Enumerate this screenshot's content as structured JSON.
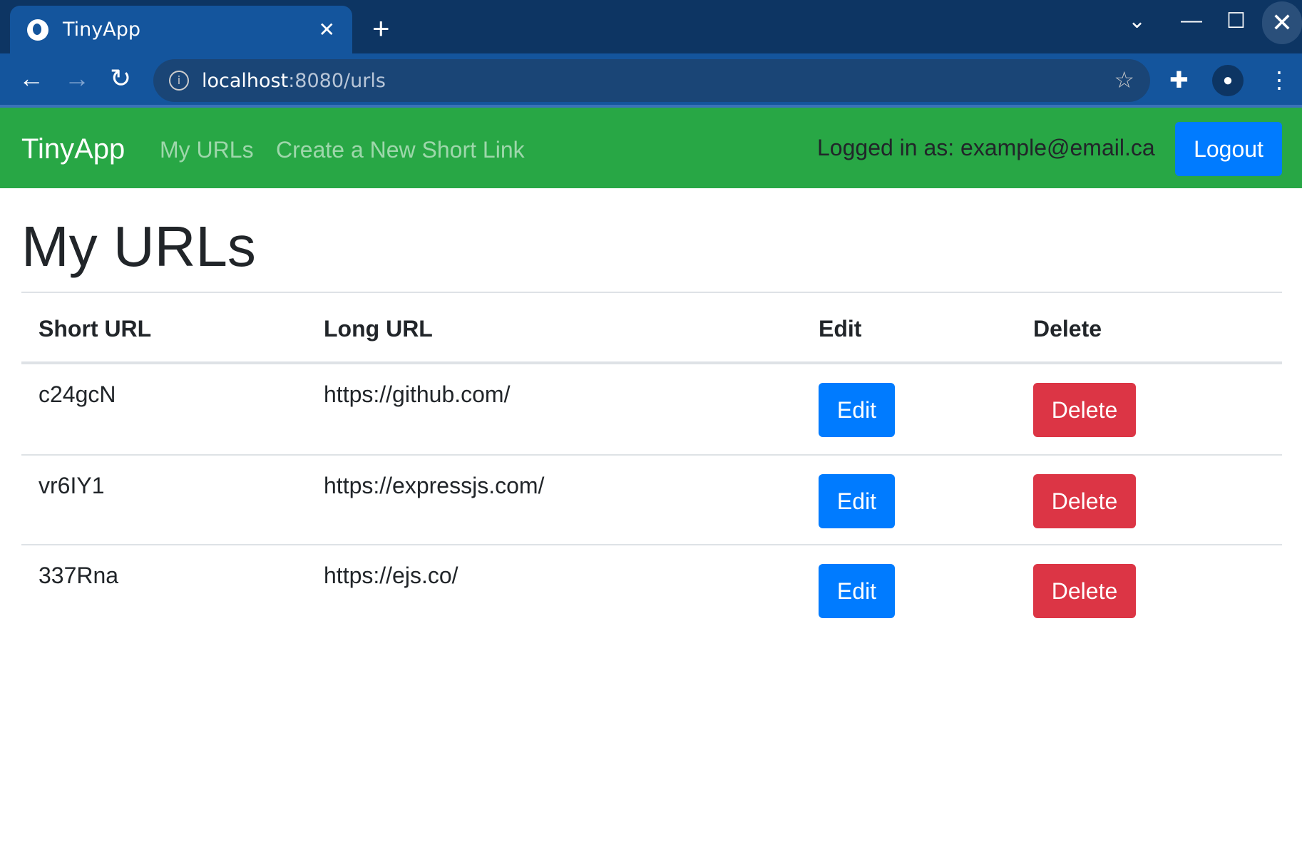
{
  "browser": {
    "tab_title": "TinyApp",
    "url_host": "localhost",
    "url_rest": ":8080/urls"
  },
  "navbar": {
    "brand": "TinyApp",
    "links": [
      "My URLs",
      "Create a New Short Link"
    ],
    "logged_in": "Logged in as: example@email.ca",
    "logout": "Logout"
  },
  "page": {
    "title": "My URLs"
  },
  "table": {
    "headers": [
      "Short URL",
      "Long URL",
      "Edit",
      "Delete"
    ],
    "rows": [
      {
        "short": "c24gcN",
        "long": "https://github.com/",
        "edit": "Edit",
        "delete": "Delete"
      },
      {
        "short": "vr6IY1",
        "long": "https://expressjs.com/",
        "edit": "Edit",
        "delete": "Delete"
      },
      {
        "short": "337Rna",
        "long": "https://ejs.co/",
        "edit": "Edit",
        "delete": "Delete"
      }
    ]
  },
  "colors": {
    "navbar": "#28a745",
    "primary": "#007bff",
    "danger": "#dc3545"
  }
}
